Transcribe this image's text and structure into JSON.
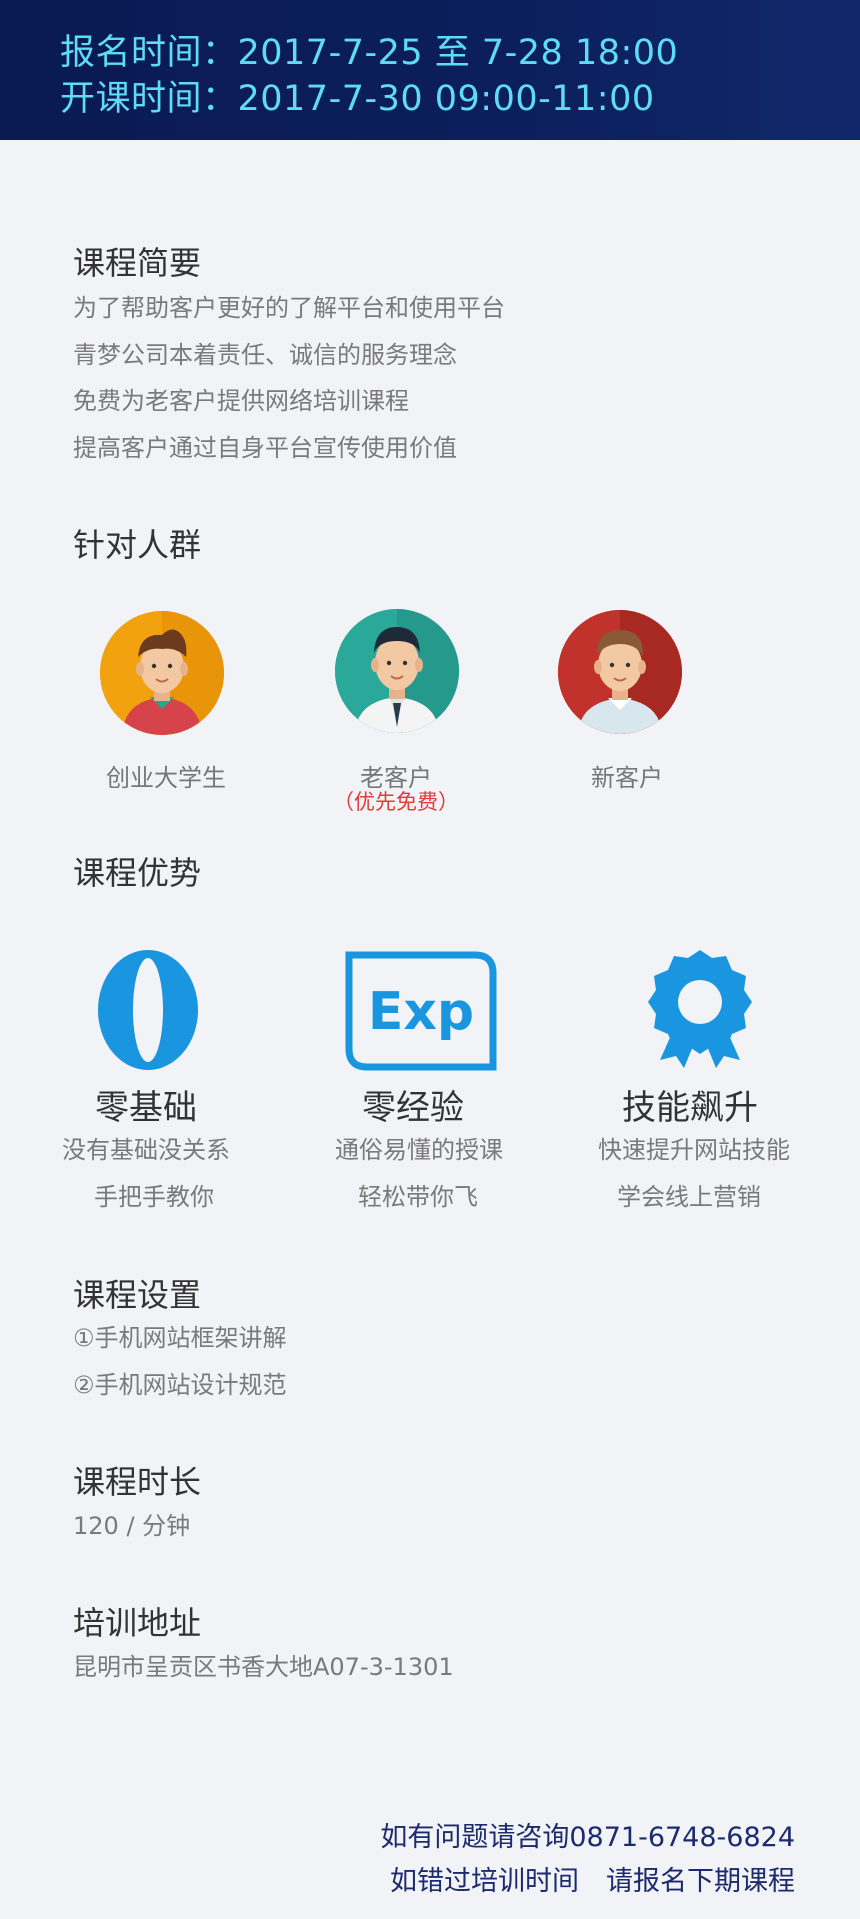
{
  "header": {
    "registration": "报名时间：2017-7-25 至 7-28 18:00",
    "class_time": "开课时间：2017-7-30  09:00-11:00",
    "gradient_colors": [
      "#0a1a52",
      "#10286b"
    ],
    "text_color": "#5fdcf5"
  },
  "summary": {
    "title": "课程简要",
    "lines": [
      "为了帮助客户更好的了解平台和使用平台",
      "青梦公司本着责任、诚信的服务理念",
      "免费为老客户提供网络培训课程",
      "提高客户通过自身平台宣传使用价值"
    ]
  },
  "audience": {
    "title": "针对人群",
    "items": [
      {
        "label": "创业大学生",
        "note": "",
        "bg": "#f2a20f",
        "avatar": "student-avatar-icon"
      },
      {
        "label": "老客户",
        "note": "（优先免费）",
        "bg": "#2aa99a",
        "avatar": "old-customer-avatar-icon"
      },
      {
        "label": "新客户",
        "note": "",
        "bg": "#c0322b",
        "avatar": "new-customer-avatar-icon"
      }
    ]
  },
  "advantages": {
    "title": "课程优势",
    "items": [
      {
        "title": "零基础",
        "lines": [
          "没有基础没关系",
          "手把手教你"
        ],
        "icon": "zero-icon"
      },
      {
        "title": "零经验",
        "lines": [
          "通俗易懂的授课",
          "轻松带你飞"
        ],
        "icon": "exp-icon",
        "icon_text": "Exp"
      },
      {
        "title": "技能飙升",
        "lines": [
          "快速提升网站技能",
          "学会线上营销"
        ],
        "icon": "award-badge-icon"
      }
    ],
    "icon_color": "#1a96e0"
  },
  "settings": {
    "title": "课程设置",
    "lines": [
      "①手机网站框架讲解",
      "②手机网站设计规范"
    ]
  },
  "duration": {
    "title": "课程时长",
    "value": "120 / 分钟"
  },
  "address": {
    "title": "培训地址",
    "value": "昆明市呈贡区书香大地A07-3-1301"
  },
  "footer": {
    "contact": "如有问题请咨询0871-6748-6824",
    "missed": "如错过培训时间　请报名下期课程"
  }
}
